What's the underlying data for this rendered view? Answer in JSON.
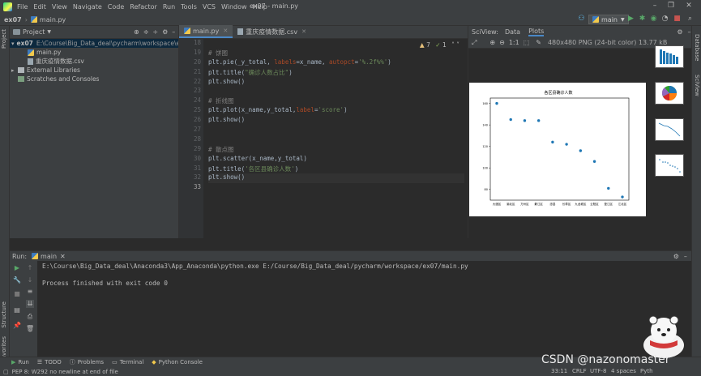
{
  "menubar": {
    "items": [
      "File",
      "Edit",
      "View",
      "Navigate",
      "Code",
      "Refactor",
      "Run",
      "Tools",
      "VCS",
      "Window",
      "Help"
    ],
    "title": "ex07 - main.py"
  },
  "navbar": {
    "project": "ex07",
    "file": "main.py",
    "run_config": "main"
  },
  "project_panel": {
    "header": "Project",
    "root": "ex07",
    "root_path": "E:\\Course\\Big_Data_deal\\pycharm\\workspace\\ex07",
    "files": [
      "main.py",
      "重庆疫情数据.csv"
    ],
    "external": "External Libraries",
    "scratches": "Scratches and Consoles"
  },
  "editor": {
    "tabs": [
      "main.py",
      "重庆疫情数据.csv"
    ],
    "warnings": "7",
    "weak": "1",
    "line_numbers": [
      "18",
      "19",
      "20",
      "21",
      "22",
      "23",
      "24",
      "25",
      "26",
      "27",
      "28",
      "29",
      "30",
      "31",
      "32",
      "33"
    ],
    "lines": [
      "",
      "# 饼图",
      "plt.pie(_y_total, labels=x_name, autopct='%.2f%%')",
      "plt.title(\"确诊人数占比\")",
      "plt.show()",
      "",
      "# 折线图",
      "plt.plot(x_name,y_total,label='score')",
      "plt.show()",
      "",
      "",
      "# 散点图",
      "plt.scatter(x_name,y_total)",
      "plt.title('各区县确诊人数')",
      "plt.show()",
      ""
    ]
  },
  "sciview": {
    "label": "SciView:",
    "tabs": [
      "Data",
      "Plots"
    ],
    "info": "480x480 PNG (24-bit color) 13.77 kB",
    "zoom": "1:1"
  },
  "chart_data": {
    "type": "scatter",
    "title": "各区县确诊人数",
    "categories": [
      "大渡区",
      "渝北区",
      "万州区",
      "綦江区",
      "忠县",
      "长寿区",
      "九龙坡区",
      "云阳区",
      "垫江区",
      "江北区"
    ],
    "values": [
      160,
      145,
      144,
      144,
      124,
      122,
      116,
      106,
      81,
      73
    ],
    "yticks": [
      80,
      100,
      120,
      140,
      160
    ],
    "ylim": [
      70,
      165
    ],
    "color": "#1f77b4"
  },
  "run_panel": {
    "label": "Run:",
    "config": "main",
    "command": "E:\\Course\\Big_Data_deal\\Anaconda3\\App_Anaconda\\python.exe E:/Course/Big_Data_deal/pycharm/workspace/ex07/main.py",
    "exit": "Process finished with exit code 0"
  },
  "bottom_tabs": [
    "Run",
    "TODO",
    "Problems",
    "Terminal",
    "Python Console"
  ],
  "status": {
    "left": "PEP 8: W292 no newline at end of file",
    "pos": "33:11",
    "crlf": "CRLF",
    "enc": "UTF-8",
    "indent": "4 spaces",
    "interp": "Pyth"
  },
  "side_tabs": {
    "left": [
      "Project",
      "Structure",
      "Favorites"
    ],
    "right": [
      "Database",
      "SciView"
    ]
  },
  "watermark": "CSDN @nazonomaster"
}
